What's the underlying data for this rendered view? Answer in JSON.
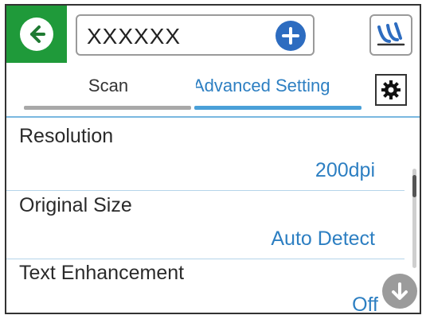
{
  "header": {
    "title": "XXXXXX",
    "icons": {
      "back": "back-arrow-icon",
      "add": "plus-icon",
      "logo": "scanner-app-logo-icon"
    },
    "colors": {
      "back_bg": "#1f9a3a",
      "add_bg": "#2d6cc0"
    }
  },
  "tabs": [
    {
      "label": "Scan",
      "active": false
    },
    {
      "label": "Advanced Setting",
      "active": true
    }
  ],
  "settings": [
    {
      "label": "Resolution",
      "value": "200dpi"
    },
    {
      "label": "Original Size",
      "value": "Auto Detect"
    },
    {
      "label": "Text Enhancement",
      "value": "Off"
    }
  ],
  "colors": {
    "accent": "#2d7fc2",
    "divider": "#b5d4ea"
  }
}
